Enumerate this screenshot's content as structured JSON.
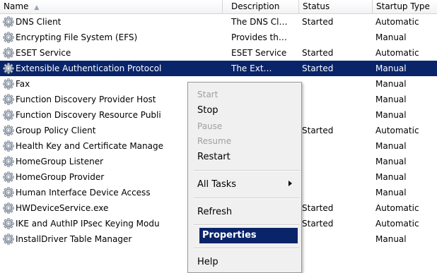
{
  "columns": {
    "name": "Name",
    "description": "Description",
    "status": "Status",
    "startup_type": "Startup Type"
  },
  "services": [
    {
      "name": "DNS Client",
      "description": "The DNS Cl…",
      "status": "Started",
      "startup": "Automatic"
    },
    {
      "name": "Encrypting File System (EFS)",
      "description": "Provides th…",
      "status": "",
      "startup": "Manual"
    },
    {
      "name": "ESET Service",
      "description": "ESET Service",
      "status": "Started",
      "startup": "Automatic"
    },
    {
      "name": "Extensible Authentication Protocol",
      "description": "The Ext…",
      "status": "Started",
      "startup": "Manual",
      "selected": true
    },
    {
      "name": "Fax",
      "description": "",
      "status": "",
      "startup": "Manual"
    },
    {
      "name": "Function Discovery Provider Host",
      "description": "",
      "status": "",
      "startup": "Manual"
    },
    {
      "name": "Function Discovery Resource Publi",
      "description": "",
      "status": "",
      "startup": "Manual"
    },
    {
      "name": "Group Policy Client",
      "description": "",
      "status": "Started",
      "startup": "Automatic"
    },
    {
      "name": "Health Key and Certificate Manage",
      "description": "",
      "status": "",
      "startup": "Manual"
    },
    {
      "name": "HomeGroup Listener",
      "description": "",
      "status": "",
      "startup": "Manual"
    },
    {
      "name": "HomeGroup Provider",
      "description": "",
      "status": "",
      "startup": "Manual"
    },
    {
      "name": "Human Interface Device Access",
      "description": "",
      "status": "",
      "startup": "Manual"
    },
    {
      "name": "HWDeviceService.exe",
      "description": "",
      "status": "Started",
      "startup": "Automatic"
    },
    {
      "name": "IKE and AuthIP IPsec Keying Modu",
      "description": "",
      "status": "Started",
      "startup": "Automatic"
    },
    {
      "name": "InstallDriver Table Manager",
      "description": "",
      "status": "",
      "startup": "Manual"
    }
  ],
  "context_menu": {
    "start": "Start",
    "stop": "Stop",
    "pause": "Pause",
    "resume": "Resume",
    "restart": "Restart",
    "all_tasks": "All Tasks",
    "refresh": "Refresh",
    "properties": "Properties",
    "help": "Help"
  },
  "colors": {
    "selection": "#0a246a",
    "menu_bg": "#f0f0f0",
    "disabled_text": "#a0a0a0"
  }
}
